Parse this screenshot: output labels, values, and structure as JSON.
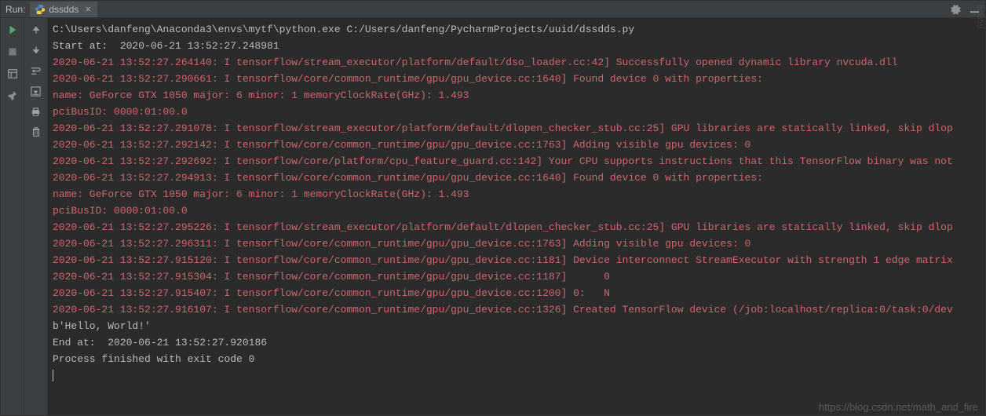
{
  "titlebar": {
    "run_label": "Run:"
  },
  "tab": {
    "name": "dssdds"
  },
  "console": {
    "lines": [
      {
        "cls": "plain",
        "text": "C:\\Users\\danfeng\\Anaconda3\\envs\\mytf\\python.exe C:/Users/danfeng/PycharmProjects/uuid/dssdds.py"
      },
      {
        "cls": "plain",
        "text": "Start at:  2020-06-21 13:52:27.248981"
      },
      {
        "cls": "err",
        "text": "2020-06-21 13:52:27.264140: I tensorflow/stream_executor/platform/default/dso_loader.cc:42] Successfully opened dynamic library nvcuda.dll"
      },
      {
        "cls": "err",
        "text": "2020-06-21 13:52:27.290661: I tensorflow/core/common_runtime/gpu/gpu_device.cc:1640] Found device 0 with properties:"
      },
      {
        "cls": "err",
        "text": "name: GeForce GTX 1050 major: 6 minor: 1 memoryClockRate(GHz): 1.493"
      },
      {
        "cls": "err",
        "text": "pciBusID: 0000:01:00.0"
      },
      {
        "cls": "err",
        "text": "2020-06-21 13:52:27.291078: I tensorflow/stream_executor/platform/default/dlopen_checker_stub.cc:25] GPU libraries are statically linked, skip dlop"
      },
      {
        "cls": "err",
        "text": "2020-06-21 13:52:27.292142: I tensorflow/core/common_runtime/gpu/gpu_device.cc:1763] Adding visible gpu devices: 0"
      },
      {
        "cls": "err",
        "text": "2020-06-21 13:52:27.292692: I tensorflow/core/platform/cpu_feature_guard.cc:142] Your CPU supports instructions that this TensorFlow binary was not"
      },
      {
        "cls": "err",
        "text": "2020-06-21 13:52:27.294913: I tensorflow/core/common_runtime/gpu/gpu_device.cc:1640] Found device 0 with properties:"
      },
      {
        "cls": "err",
        "text": "name: GeForce GTX 1050 major: 6 minor: 1 memoryClockRate(GHz): 1.493"
      },
      {
        "cls": "err",
        "text": "pciBusID: 0000:01:00.0"
      },
      {
        "cls": "err",
        "text": "2020-06-21 13:52:27.295226: I tensorflow/stream_executor/platform/default/dlopen_checker_stub.cc:25] GPU libraries are statically linked, skip dlop"
      },
      {
        "cls": "err",
        "text": "2020-06-21 13:52:27.296311: I tensorflow/core/common_runtime/gpu/gpu_device.cc:1763] Adding visible gpu devices: 0"
      },
      {
        "cls": "err",
        "text": "2020-06-21 13:52:27.915120: I tensorflow/core/common_runtime/gpu/gpu_device.cc:1181] Device interconnect StreamExecutor with strength 1 edge matrix"
      },
      {
        "cls": "err",
        "text": "2020-06-21 13:52:27.915304: I tensorflow/core/common_runtime/gpu/gpu_device.cc:1187]      0"
      },
      {
        "cls": "err",
        "text": "2020-06-21 13:52:27.915407: I tensorflow/core/common_runtime/gpu/gpu_device.cc:1200] 0:   N"
      },
      {
        "cls": "err",
        "text": "2020-06-21 13:52:27.916107: I tensorflow/core/common_runtime/gpu/gpu_device.cc:1326] Created TensorFlow device (/job:localhost/replica:0/task:0/dev"
      },
      {
        "cls": "plain",
        "text": "b'Hello, World!'"
      },
      {
        "cls": "plain",
        "text": "End at:  2020-06-21 13:52:27.920186"
      },
      {
        "cls": "plain",
        "text": ""
      },
      {
        "cls": "plain",
        "text": "Process finished with exit code 0"
      }
    ]
  },
  "watermark": {
    "side": "80359",
    "bottom": "https://blog.csdn.net/math_and_fire"
  }
}
